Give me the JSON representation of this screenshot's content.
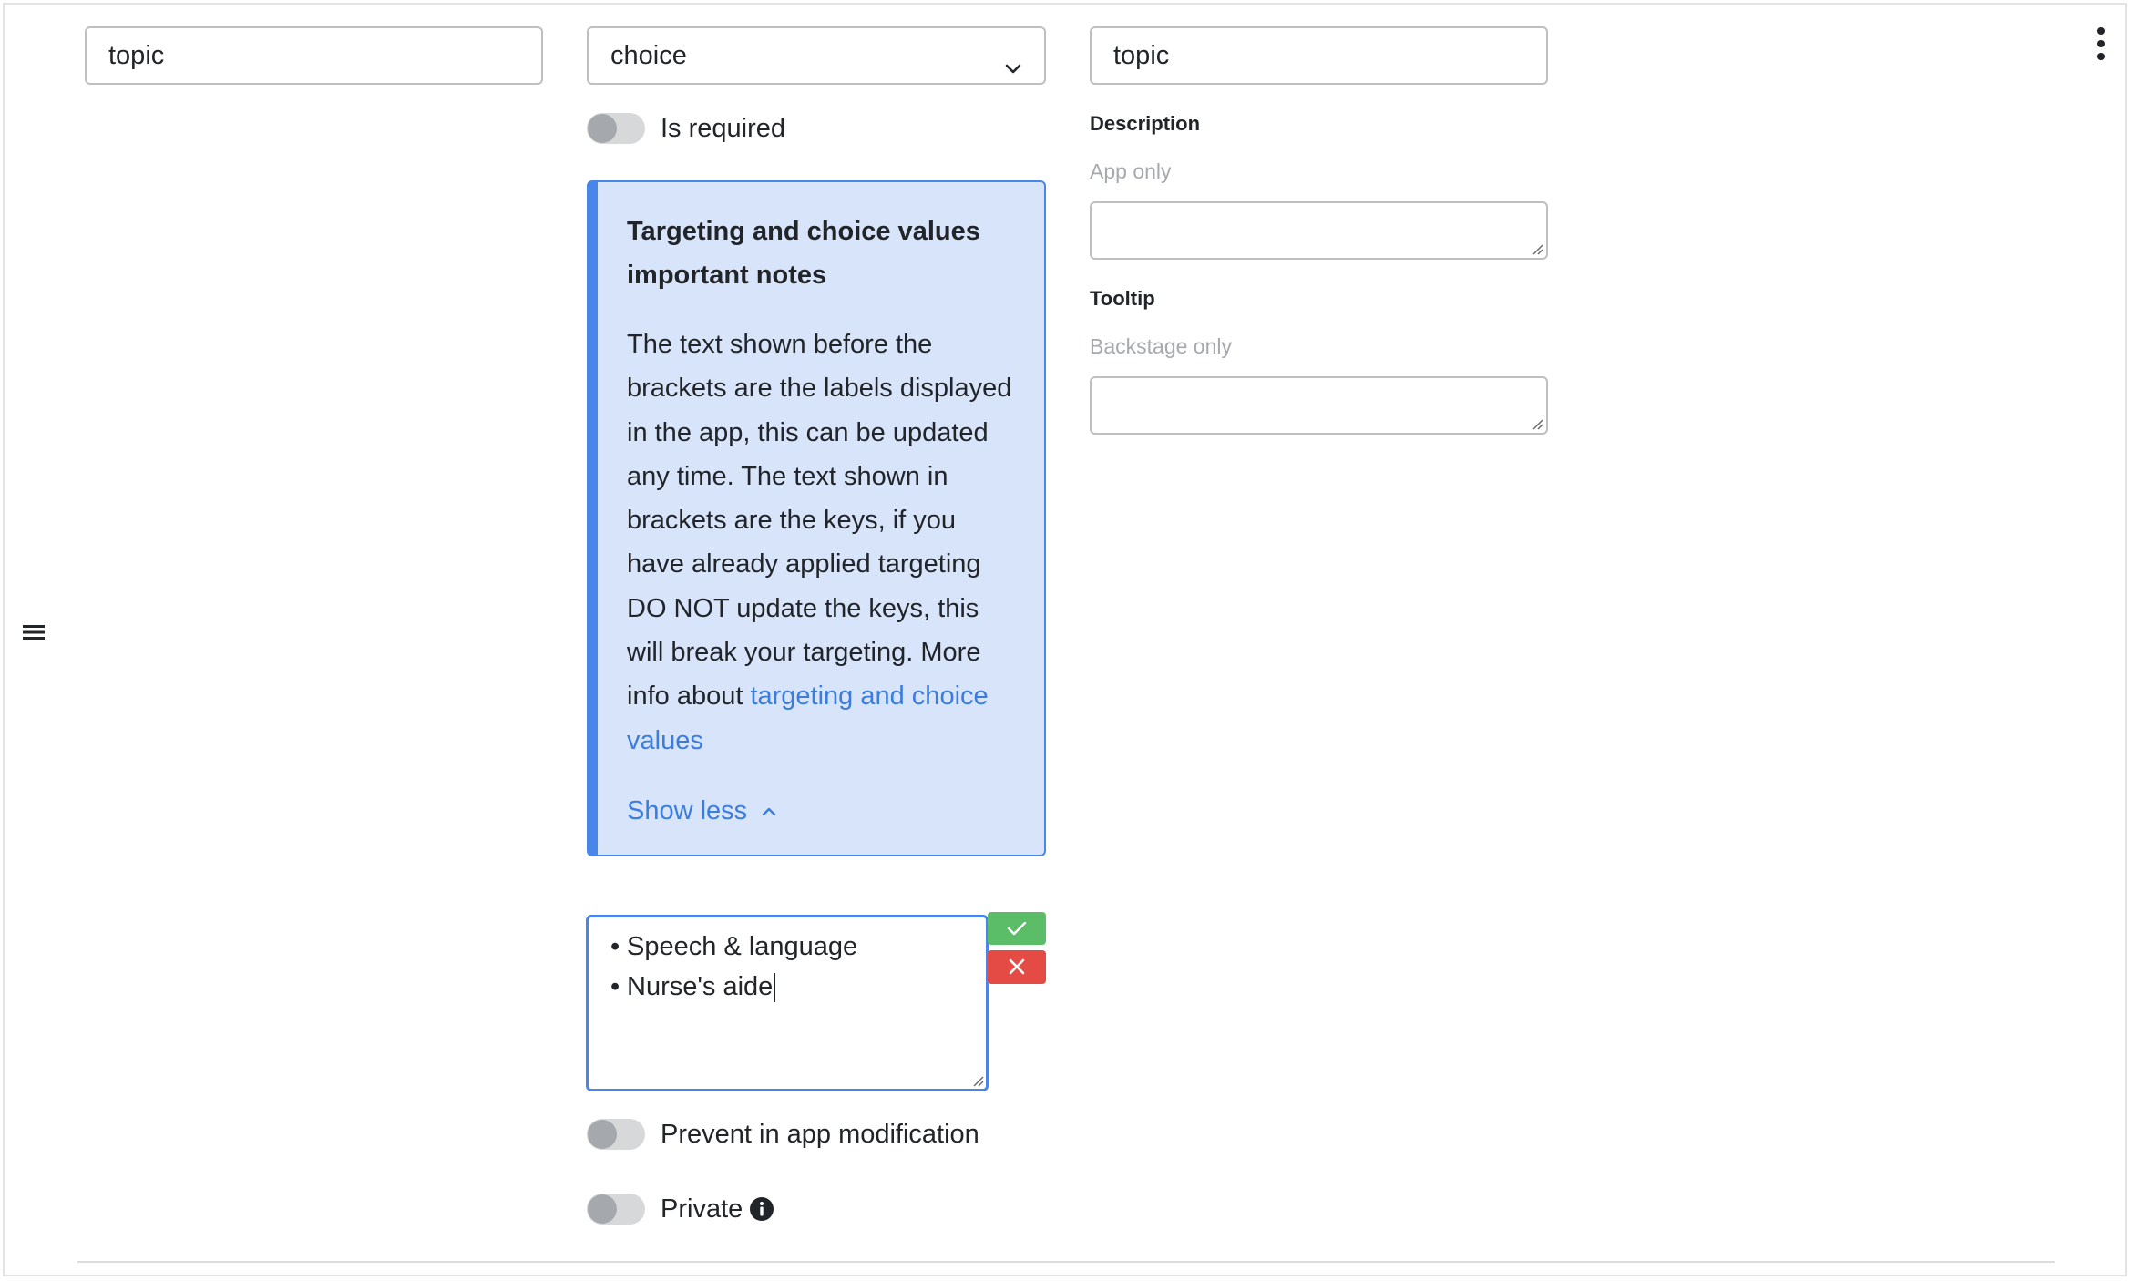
{
  "left_field": {
    "value": "topic"
  },
  "type_select": {
    "value": "choice"
  },
  "key_field": {
    "value": "topic"
  },
  "toggles": {
    "is_required": {
      "label": "Is required",
      "on": false
    },
    "prevent_modification": {
      "label": "Prevent in app modification",
      "on": false
    },
    "private": {
      "label": "Private",
      "on": false
    }
  },
  "note": {
    "title": "Targeting and choice values important notes",
    "body": "The text shown before the brackets are the labels displayed in the app, this can be updated any time. The text shown in brackets are the keys, if you have already applied targeting DO NOT update the keys, this will break your targeting. More info about ",
    "link": "targeting and choice values",
    "show_less": "Show less"
  },
  "description": {
    "label": "Description",
    "hint": "App only",
    "value": ""
  },
  "tooltip": {
    "label": "Tooltip",
    "hint": "Backstage only",
    "value": ""
  },
  "choices": {
    "items": [
      "Speech & language",
      "Nurse's aide"
    ],
    "bullet": "•"
  },
  "colors": {
    "accent": "#4a86e8",
    "note_bg": "#d8e4fa",
    "link": "#3b7ddd",
    "confirm": "#5cbd68",
    "cancel": "#e54b45"
  },
  "icons": {
    "drag": "hamburger-icon",
    "menu": "kebab-icon",
    "select": "chevron-down-icon",
    "show_less": "chevron-up-icon",
    "confirm": "check-icon",
    "cancel": "close-icon",
    "info": "info-icon"
  }
}
